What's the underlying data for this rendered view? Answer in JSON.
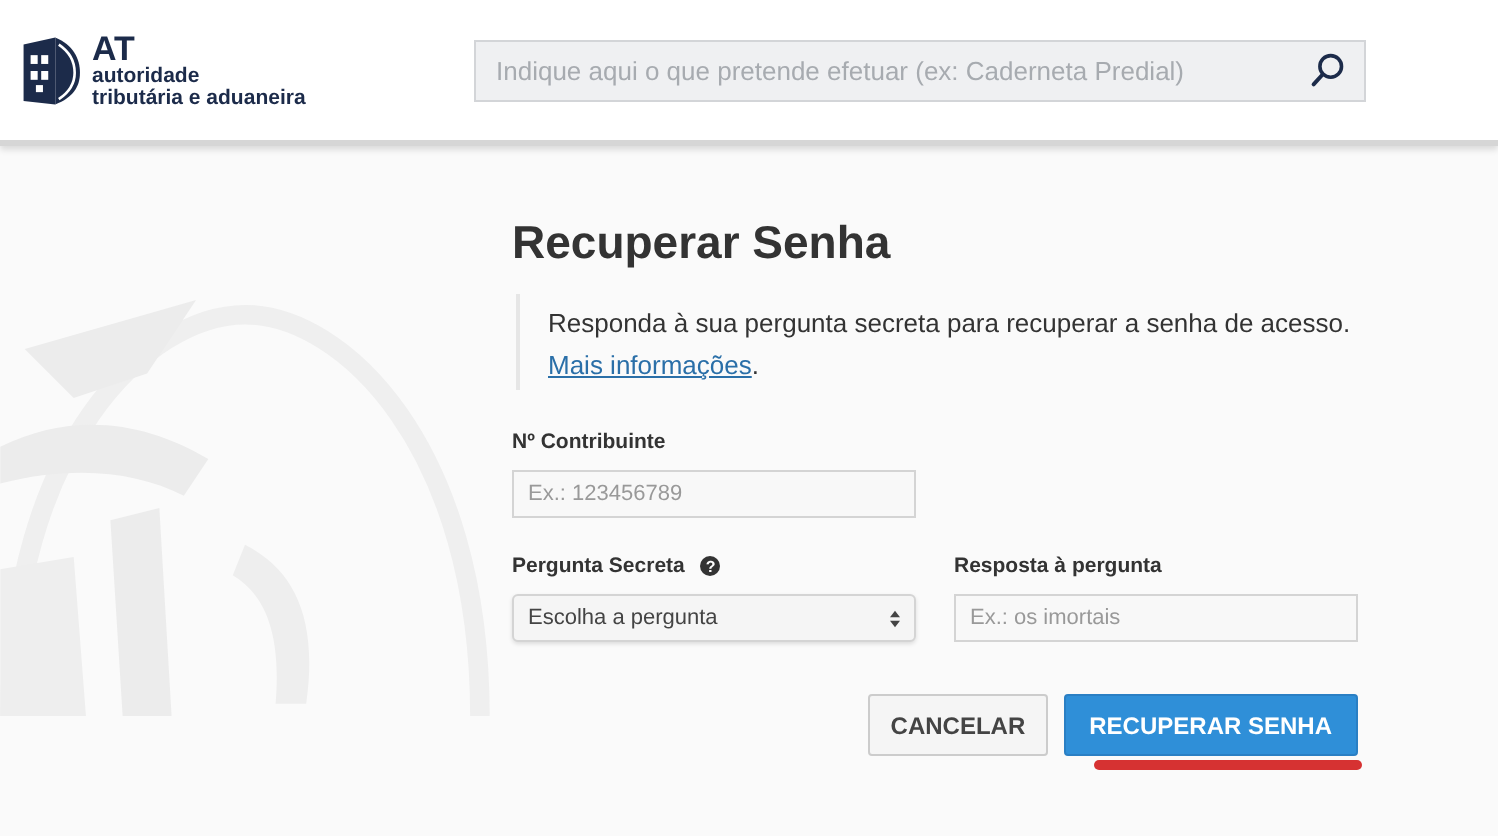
{
  "header": {
    "logo": {
      "abbr": "AT",
      "line1": "autoridade",
      "line2": "tributária e aduaneira"
    },
    "search": {
      "placeholder": "Indique aqui o que pretende efetuar (ex: Caderneta Predial)"
    }
  },
  "form": {
    "title": "Recuperar Senha",
    "intro": "Responda à sua pergunta secreta para recuperar a senha de acesso.",
    "more_link": "Mais informações",
    "more_after": ".",
    "nif": {
      "label": "Nº Contribuinte",
      "placeholder": "Ex.: 123456789"
    },
    "question": {
      "label": "Pergunta Secreta",
      "help": "?",
      "value": "Escolha a pergunta"
    },
    "answer": {
      "label": "Resposta à pergunta",
      "placeholder": "Ex.: os imortais"
    },
    "buttons": [
      {
        "label": "CANCELAR",
        "kind": "secondary"
      },
      {
        "label": "RECUPERAR SENHA",
        "kind": "primary"
      }
    ]
  }
}
